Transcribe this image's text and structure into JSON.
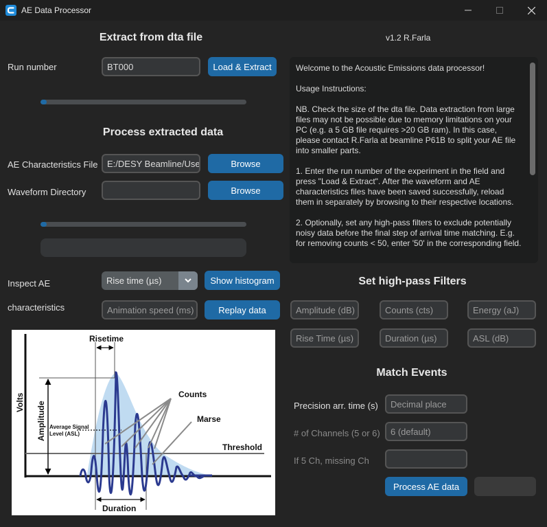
{
  "window": {
    "title": "AE Data Processor",
    "controls": [
      "minimize-icon",
      "maximize-icon",
      "close-icon"
    ]
  },
  "version": "v1.2 R.Farla",
  "extract": {
    "heading": "Extract from dta file",
    "run_label": "Run number",
    "run_value": "BT000",
    "load_button": "Load & Extract",
    "progress": 0.03
  },
  "process": {
    "heading": "Process extracted data",
    "char_file_label": "AE Characteristics File",
    "char_file_value": "E:/DESY Beamline/User",
    "browse_label": "Browse",
    "waveform_label": "Waveform Directory",
    "waveform_value": "",
    "browse2_label": "Browse",
    "progress": 0.03,
    "status_text": ""
  },
  "instructions": {
    "text": "Welcome to the Acoustic Emissions data processor!\n\nUsage Instructions:\n\nNB. Check the size of the dta file. Data extraction from large files may not be possible due to memory limitations on your PC (e.g. a 5 GB file requires >20 GB ram). In this case, please contact R.Farla at beamline P61B to split your AE file into smaller parts.\n\n1. Enter the run number of the experiment in the field and press \"Load & Extract\". After the waveform and AE characteristics files have been saved successfully, reload them in separately by browsing to their respective locations.\n\n2. Optionally, set any high-pass filters to exclude potentially noisy data before the final step of arrival time matching. E.g. for removing counts < 50, enter '50' in the corresponding field."
  },
  "inspect": {
    "label_line1": "Inspect AE",
    "label_line2": "characteristics",
    "select_value": "Rise time (µs)",
    "histogram_button": "Show histogram",
    "animation_placeholder": "Animation speed (ms)",
    "replay_button": "Replay data"
  },
  "filters": {
    "heading": "Set high-pass Filters",
    "fields": [
      "Amplitude (dB)",
      "Counts (cts)",
      "Energy (aJ)",
      "Rise Time (µs)",
      "Duration (µs)",
      "ASL (dB)"
    ]
  },
  "match": {
    "heading": "Match Events",
    "precision_label": "Precision arr. time (s)",
    "precision_placeholder": "Decimal place",
    "channels_label": "# of Channels (5 or 6)",
    "channels_placeholder": "6 (default)",
    "missing_label": "If 5 Ch, missing Ch",
    "missing_value": "",
    "process_button": "Process AE data",
    "secondary_button": ""
  },
  "diagram_labels": {
    "risetime": "Risetime",
    "counts": "Counts",
    "marse": "Marse",
    "threshold": "Threshold",
    "amplitude": "Amplitude",
    "volts": "Volts",
    "asl_line1": "Average Signal",
    "asl_line2": "Level (ASL)",
    "duration": "Duration"
  },
  "colors": {
    "accent": "#1f6aa5",
    "background": "#242424",
    "wave": "#2b3a8f",
    "envelope": "#b9d7f0"
  }
}
